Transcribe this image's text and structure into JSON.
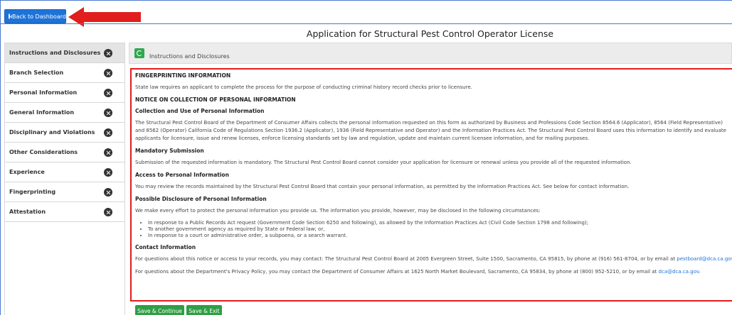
{
  "back_button": {
    "label": "Back to Dashboard",
    "icon": "back-circle-icon"
  },
  "page_title": "Application for Structural Pest Control Operator License",
  "sidebar": {
    "items": [
      {
        "label": "Instructions and Disclosures",
        "active": true
      },
      {
        "label": "Branch Selection"
      },
      {
        "label": "Personal Information"
      },
      {
        "label": "General Information"
      },
      {
        "label": "Disciplinary and Violations"
      },
      {
        "label": "Other Considerations"
      },
      {
        "label": "Experience"
      },
      {
        "label": "Fingerprinting"
      },
      {
        "label": "Attestation"
      }
    ]
  },
  "content_header": {
    "label": "Instructions and Disclosures"
  },
  "sections": {
    "fingerprinting_heading": "FINGERPRINTING INFORMATION",
    "fingerprinting_text": "State law requires an applicant to complete the process for the purpose of conducting criminal history record checks prior to licensure.",
    "notice_heading": "NOTICE ON COLLECTION OF PERSONAL INFORMATION",
    "collection_heading": "Collection and Use of Personal Information",
    "collection_text": "The Structural Pest Control Board of the Department of Consumer Affairs collects the personal information requested on this form as authorized by Business and Professions Code Section 8564.6 (Applicator), 8564 (Field Representative) and 8562 (Operator) California Code of Regulations Section 1936.2 (Applicator), 1936 (Field Representative and Operator) and the Information Practices Act. The Structural Pest Control Board uses this information to identify and evaluate applicants for licensure, issue and renew licenses, enforce licensing standards set by law and regulation, update and maintain current licensee information, and for mailing purposes.",
    "mandatory_heading": "Mandatory Submission",
    "mandatory_text": "Submission of the requested information is mandatory. The Structural Pest Control Board cannot consider your application for licensure or renewal unless you provide all of the requested information.",
    "access_heading": "Access to Personal Information",
    "access_text": "You may review the records maintained by the Structural Pest Control Board that contain your personal information, as permitted by the Information Practices Act. See below for contact information.",
    "disclosure_heading": "Possible Disclosure of Personal Information",
    "disclosure_text": "We make every effort to protect the personal information you provide us. The information you provide, however, may be disclosed in the following circumstances:",
    "disclosure_items": [
      "In response to a Public Records Act request (Government Code Section 6250 and following), as allowed by the Information Practices Act (Civil Code Section 1798 and following);",
      "To another government agency as required by State or Federal law; or,",
      "In response to a court or administrative order, a subpoena, or a search warrant."
    ],
    "contact_heading": "Contact Information",
    "contact_text_1": "For questions about this notice or access to your records, you may contact: The Structural Pest Control Board at 2005 Evergreen Street, Suite 1500, Sacramento, CA 95815, by phone at (916) 561-8704, or by email at",
    "contact_email_1": "pestboard@dca.ca.gov",
    "contact_text_2": "For questions about the Department's Privacy Policy, you may contact the Department of Consumer Affairs at 1625 North Market Boulevard, Sacramento, CA 95834, by phone at (800) 952-5210, or by email at",
    "contact_email_2": "dca@dca.ca.gov"
  },
  "buttons": {
    "save_continue": "Save & Continue",
    "save_exit": "Save & Exit"
  },
  "colors": {
    "primary": "#1e73d8",
    "success": "#2f9e44",
    "highlight": "#e11d1d"
  }
}
